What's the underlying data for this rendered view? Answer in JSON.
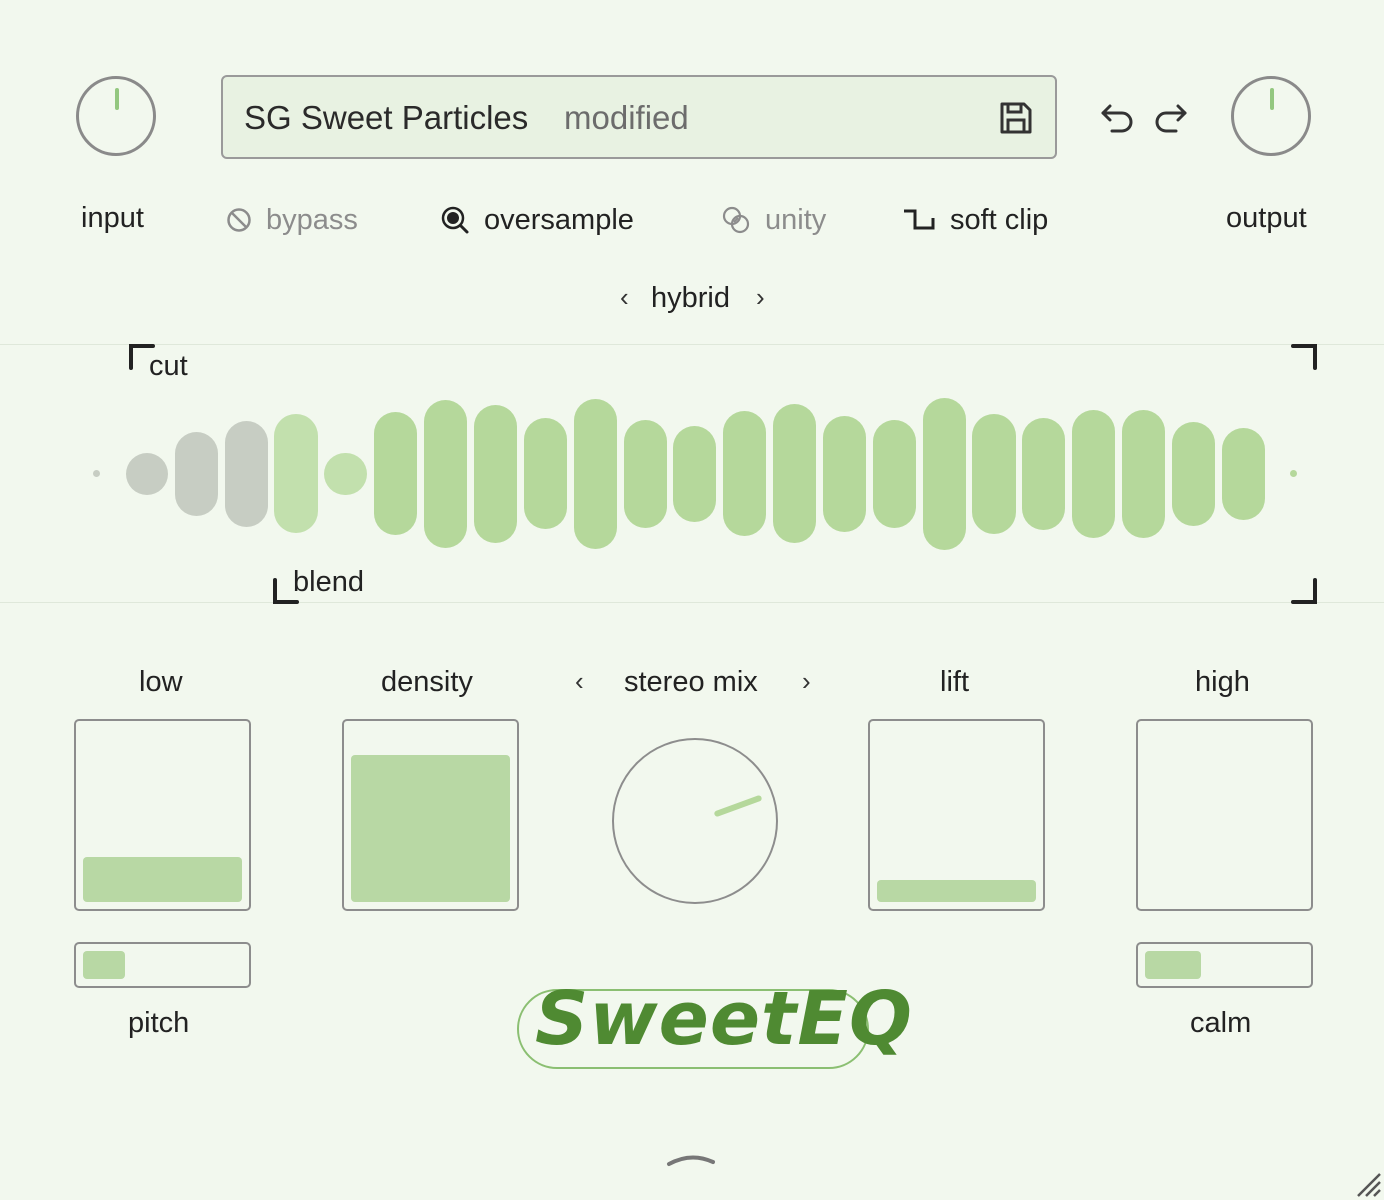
{
  "preset": {
    "name": "SG Sweet Particles",
    "status": "modified",
    "save_icon": "save-icon"
  },
  "history": {
    "undo_icon": "undo-icon",
    "redo_icon": "redo-icon"
  },
  "input": {
    "label": "input",
    "level": 0.5
  },
  "output": {
    "label": "output",
    "level": 0.5
  },
  "toggles": {
    "bypass": {
      "label": "bypass",
      "icon": "bypass-icon",
      "active": false
    },
    "oversample": {
      "label": "oversample",
      "icon": "oversample-icon",
      "active": true
    },
    "unity": {
      "label": "unity",
      "icon": "unity-icon",
      "active": false
    },
    "soft_clip": {
      "label": "soft clip",
      "icon": "soft-clip-icon",
      "active": true
    }
  },
  "mode": {
    "prev": "‹",
    "value": "hybrid",
    "next": "›"
  },
  "eq": {
    "cut_label": "cut",
    "blend_label": "blend"
  },
  "controls": {
    "low": {
      "label": "low",
      "level": 0.25
    },
    "density": {
      "label": "density",
      "level": 0.84
    },
    "stereo_mix": {
      "label": "stereo mix",
      "prev": "‹",
      "next": "›",
      "angle_deg": 70
    },
    "lift": {
      "label": "lift",
      "level": 0.12
    },
    "high": {
      "label": "high",
      "level": 0.0
    },
    "pitch": {
      "label": "pitch",
      "level": 0.25
    },
    "calm": {
      "label": "calm",
      "level": 0.35
    }
  },
  "logo": {
    "text": "SweetEQ"
  },
  "footer": {
    "expand_icon": "chevron-up-icon",
    "resize_icon": "resize-grip-icon"
  },
  "colors": {
    "background": "#f2f8ee",
    "accent_green": "#b5d89b",
    "logo_green": "#4f8a32",
    "outline_grey": "#8a8a8a"
  }
}
